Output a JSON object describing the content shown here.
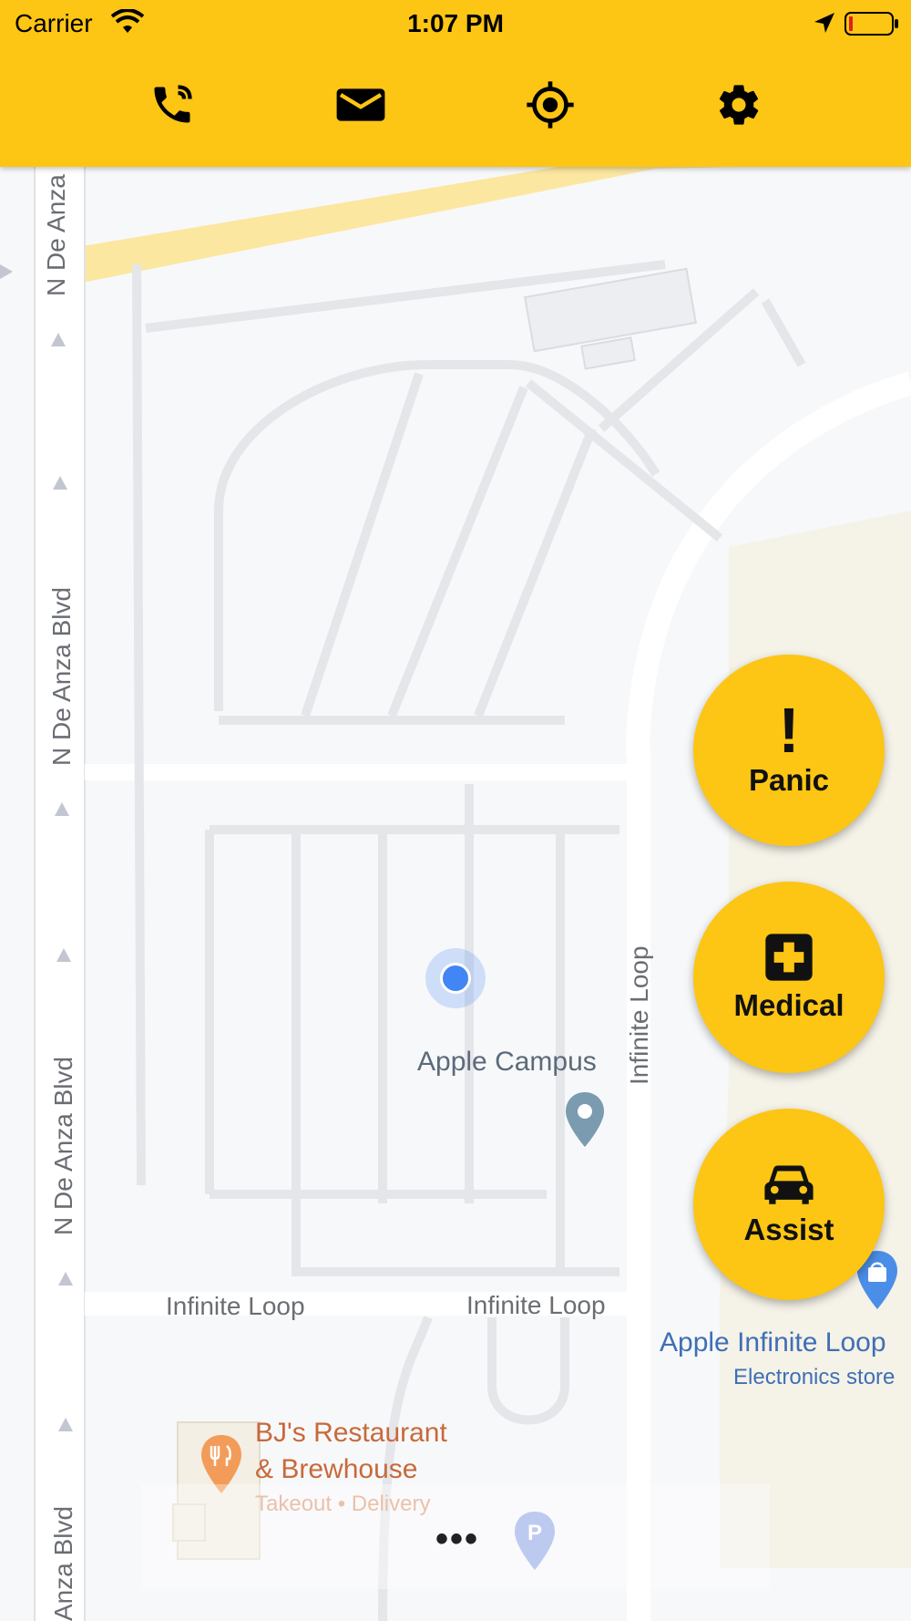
{
  "status_bar": {
    "carrier": "Carrier",
    "time": "1:07 PM"
  },
  "header": {
    "background": "#fdc514",
    "buttons": [
      {
        "name": "phone-icon"
      },
      {
        "name": "mail-icon"
      },
      {
        "name": "location-target-icon"
      },
      {
        "name": "gear-icon"
      }
    ]
  },
  "map": {
    "roads": {
      "de_anza_1": "N De Anza",
      "de_anza_2": "N De Anza Blvd",
      "de_anza_3": "N De Anza Blvd",
      "de_anza_4": "Anza Blvd",
      "infinite_loop_vertical": "Infinite Loop",
      "infinite_loop_left": "Infinite Loop",
      "infinite_loop_right": "Infinite Loop"
    },
    "campus_label": "Apple Campus",
    "store": {
      "name": "Apple Infinite Loop",
      "category": "Electronics store"
    },
    "restaurant": {
      "name_line1": "BJ's Restaurant",
      "name_line2": "& Brewhouse",
      "sub": "Takeout • Delivery"
    },
    "parking_icon": "P"
  },
  "actions": {
    "panic": {
      "label": "Panic",
      "symbol": "!"
    },
    "medical": {
      "label": "Medical"
    },
    "assist": {
      "label": "Assist"
    }
  },
  "more_button": "•••"
}
